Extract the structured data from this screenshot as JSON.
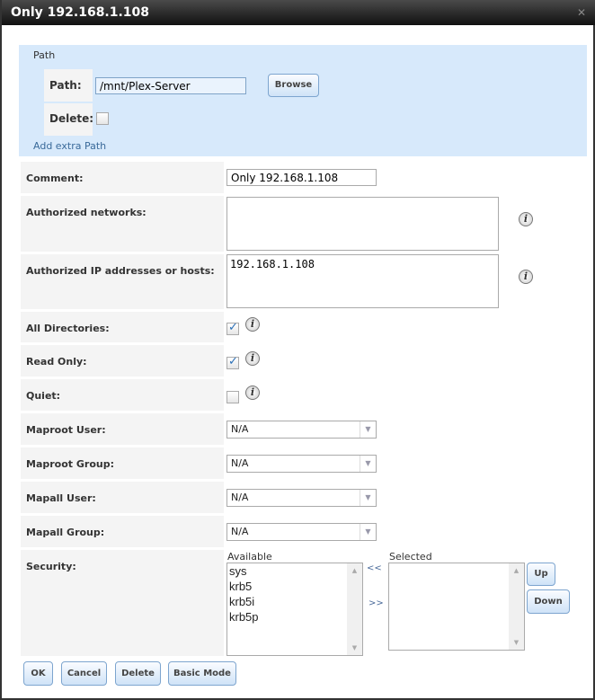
{
  "title": "Only 192.168.1.108",
  "close_icon": "close-icon",
  "path_section": {
    "legend": "Path",
    "path_label": "Path:",
    "path_value": "/mnt/Plex-Server",
    "browse": "Browse",
    "delete_label": "Delete:",
    "delete_checked": false,
    "add_extra": "Add extra Path"
  },
  "fields": {
    "comment": {
      "label": "Comment:",
      "value": "Only 192.168.1.108"
    },
    "networks": {
      "label": "Authorized networks:",
      "value": ""
    },
    "hosts": {
      "label": "Authorized IP addresses or hosts:",
      "value": "192.168.1.108"
    },
    "all_dirs": {
      "label": "All Directories:",
      "checked": true
    },
    "read_only": {
      "label": "Read Only:",
      "checked": true
    },
    "quiet": {
      "label": "Quiet:",
      "checked": false
    },
    "maproot_user": {
      "label": "Maproot User:",
      "value": "N/A"
    },
    "maproot_group": {
      "label": "Maproot Group:",
      "value": "N/A"
    },
    "mapall_user": {
      "label": "Mapall User:",
      "value": "N/A"
    },
    "mapall_group": {
      "label": "Mapall Group:",
      "value": "N/A"
    },
    "security": {
      "label": "Security:",
      "available_label": "Available",
      "selected_label": "Selected",
      "available": [
        "sys",
        "krb5",
        "krb5i",
        "krb5p"
      ],
      "selected": [],
      "move_left": "<<",
      "move_right": ">>",
      "up": "Up",
      "down": "Down"
    }
  },
  "buttons": {
    "ok": "OK",
    "cancel": "Cancel",
    "delete": "Delete",
    "basic": "Basic Mode"
  }
}
